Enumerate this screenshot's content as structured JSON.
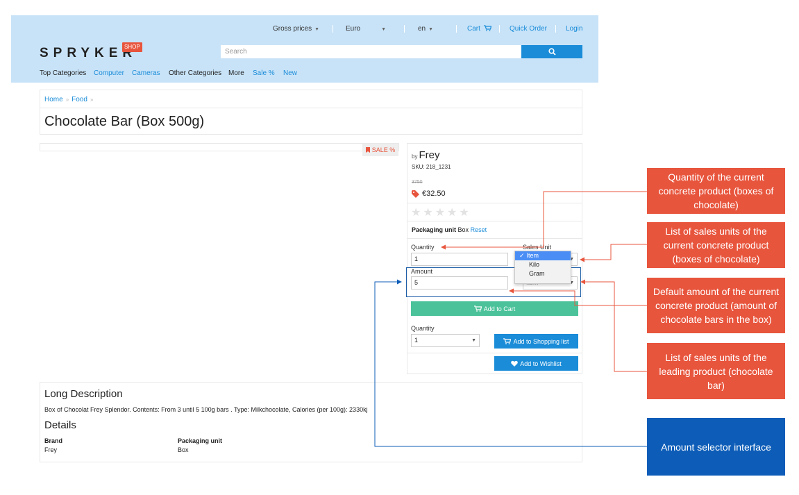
{
  "header": {
    "topbar": {
      "prices": "Gross prices",
      "currency": "Euro",
      "language": "en",
      "cart": "Cart",
      "quick_order": "Quick Order",
      "login": "Login"
    },
    "logo": "SPRYKER",
    "logo_badge": "SHOP",
    "search_placeholder": "Search",
    "nav": [
      "Top Categories",
      "Computer",
      "Cameras",
      "Other Categories",
      "More",
      "Sale %",
      "New"
    ]
  },
  "breadcrumb": [
    "Home",
    "Food"
  ],
  "page_title": "Chocolate Bar (Box 500g)",
  "sale_badge": "SALE %",
  "product": {
    "by": "by",
    "brand": "Frey",
    "sku": "SKU: 218_1231",
    "old_price": "3750",
    "price": "€32.50",
    "rating_stars": 0,
    "packaging_label": "Packaging unit",
    "packaging_value": "Box",
    "reset": "Reset",
    "quantity_label": "Quantity",
    "quantity_value": "1",
    "sales_unit_label": "Sales Unit",
    "sales_unit_options": [
      "Item",
      "Kilo",
      "Gram"
    ],
    "sales_unit_selected": "Item",
    "amount_label": "Amount",
    "amount_value": "5",
    "amount_unit": "Item",
    "add_to_cart": "Add to Cart",
    "list_quantity_label": "Quantity",
    "list_quantity_value": "1",
    "add_to_shopping_list": "Add to Shopping list",
    "add_to_wishlist": "Add to Wishlist"
  },
  "description": {
    "title": "Long Description",
    "text": "Box of Chocolat Frey Splendor. Contents: From 3 until 5 100g bars . Type: Milkchocolate, Calories (per 100g): 2330kj",
    "details_title": "Details",
    "brand_label": "Brand",
    "brand_value": "Frey",
    "packaging_label": "Packaging unit",
    "packaging_value": "Box"
  },
  "annotations": {
    "quantity_current": "Quantity of the current concrete product (boxes of chocolate)",
    "sales_units_current": "List of sales units of the current concrete product (boxes of chocolate)",
    "default_amount": "Default amount of the current concrete product (amount of chocolate bars in the box)",
    "sales_units_leading": "List of sales units of the leading product (chocolate bar)",
    "amount_selector": "Amount selector interface"
  },
  "colors": {
    "header_bg": "#c8e3f8",
    "link": "#1a8cd8",
    "callout_red": "#e8553d",
    "callout_blue": "#0d5db8",
    "cart_button": "#4cc29a"
  }
}
